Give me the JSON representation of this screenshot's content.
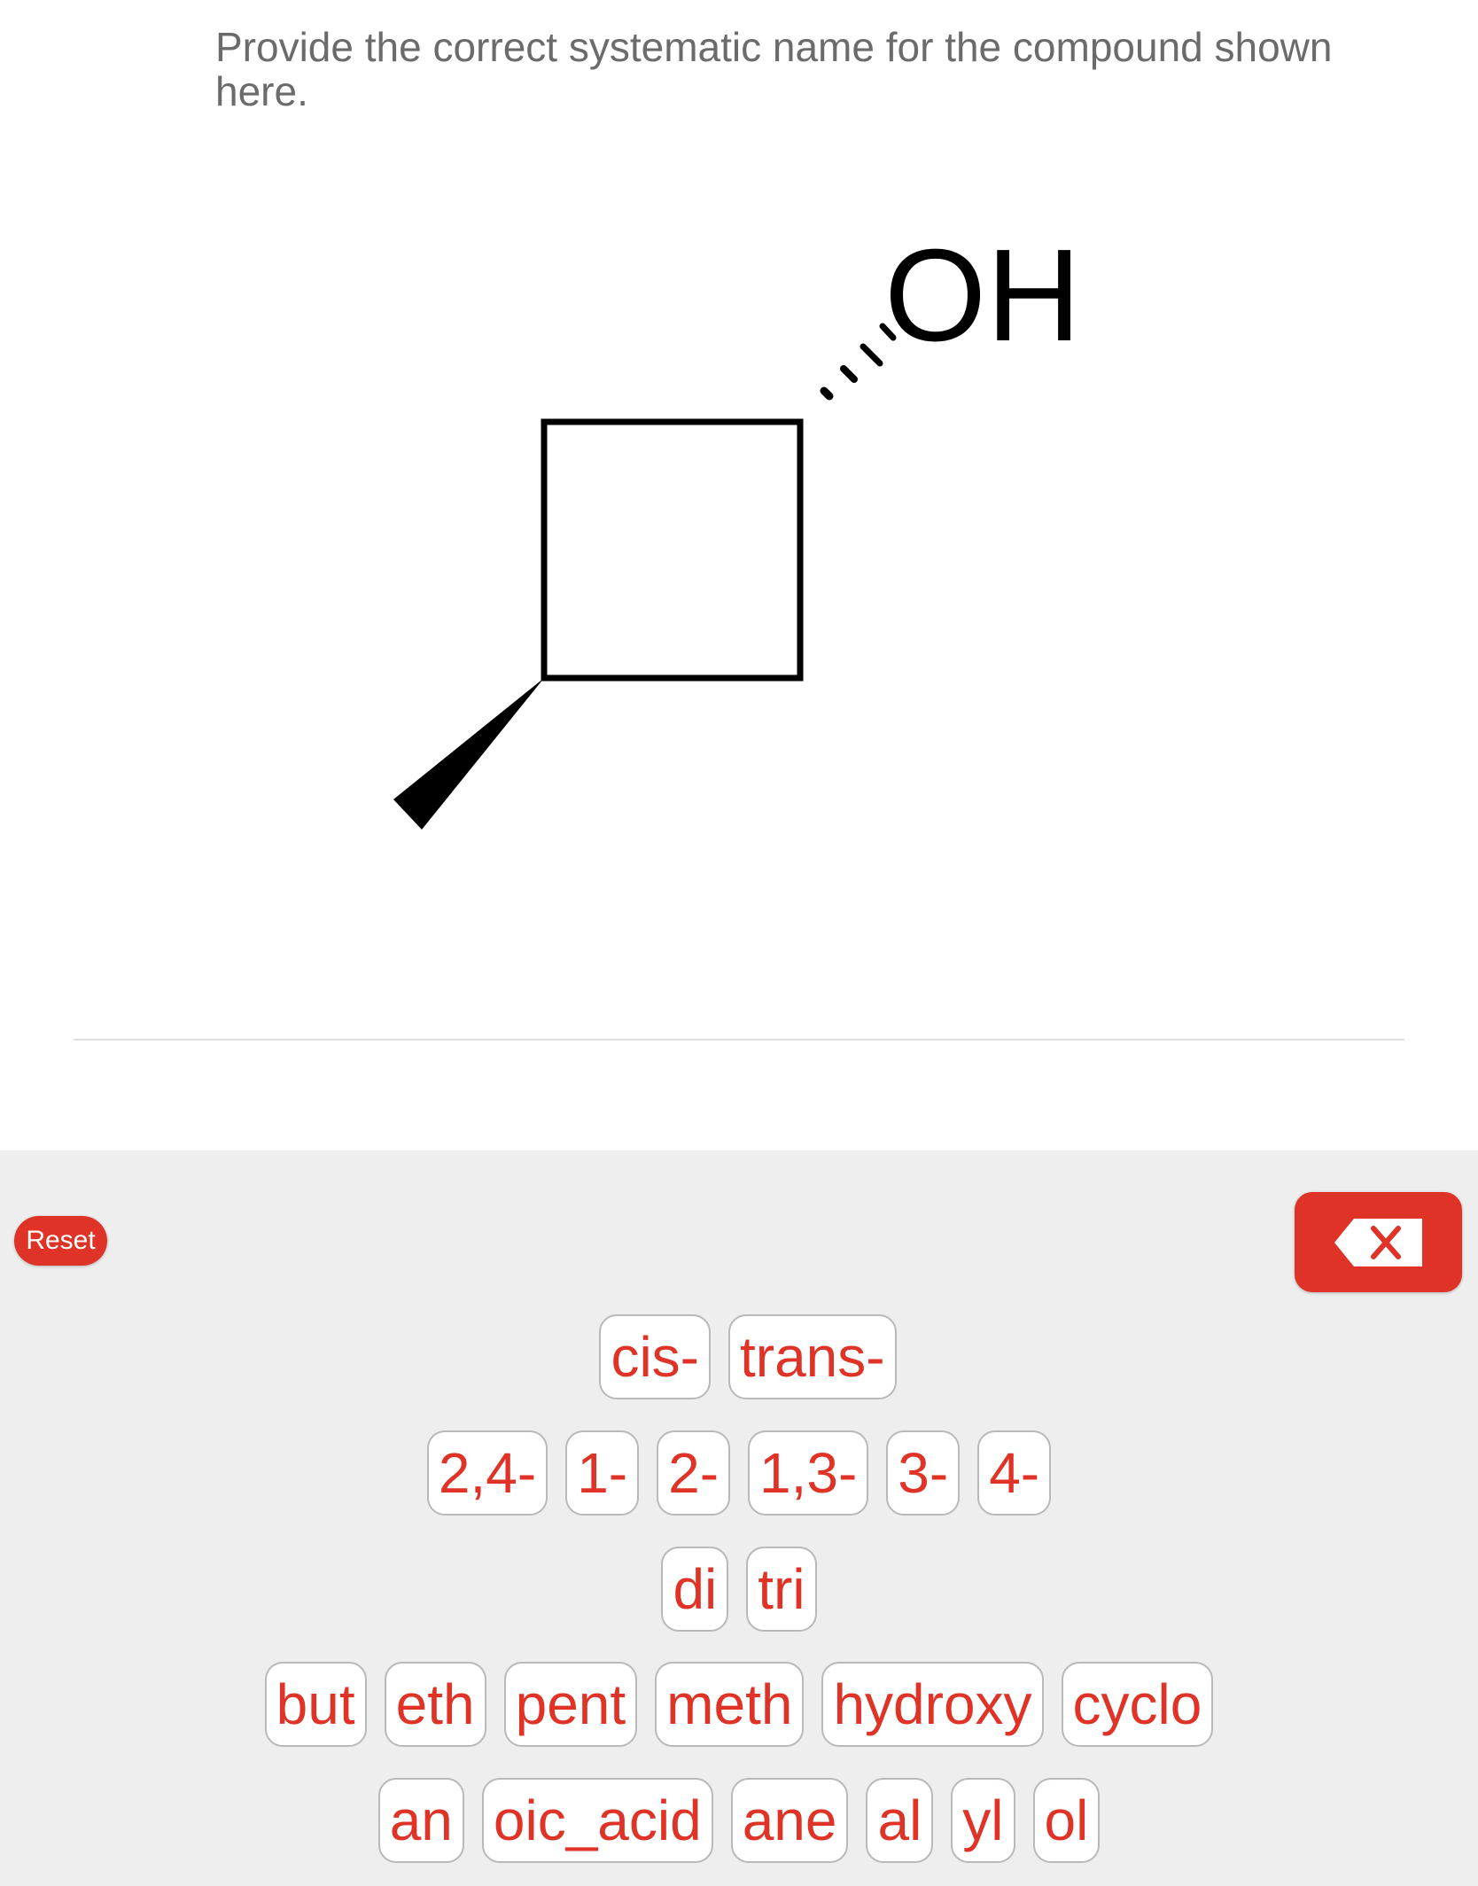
{
  "question": {
    "prompt": "Provide the correct systematic name for the compound shown here."
  },
  "molecule": {
    "label_oh": "OH",
    "ring": "cyclobutane",
    "substituents": [
      "OH (hashed wedge)",
      "methyl (solid wedge)"
    ]
  },
  "controls": {
    "reset_label": "Reset",
    "backspace_icon": "backspace-icon"
  },
  "keyboard": {
    "row1": [
      "cis-",
      "trans-"
    ],
    "row2": [
      "2,4-",
      "1-",
      "2-",
      "1,3-",
      "3-",
      "4-"
    ],
    "row3": [
      "di",
      "tri"
    ],
    "row4": [
      "but",
      "eth",
      "pent",
      "meth",
      "hydroxy",
      "cyclo"
    ],
    "row5": [
      "an",
      "oic_acid",
      "ane",
      "al",
      "yl",
      "ol"
    ]
  },
  "colors": {
    "accent": "#de3326",
    "prompt_text": "#6b6b6b",
    "keyboard_bg": "#eeeeee",
    "tile_border": "#b9b9b9"
  }
}
